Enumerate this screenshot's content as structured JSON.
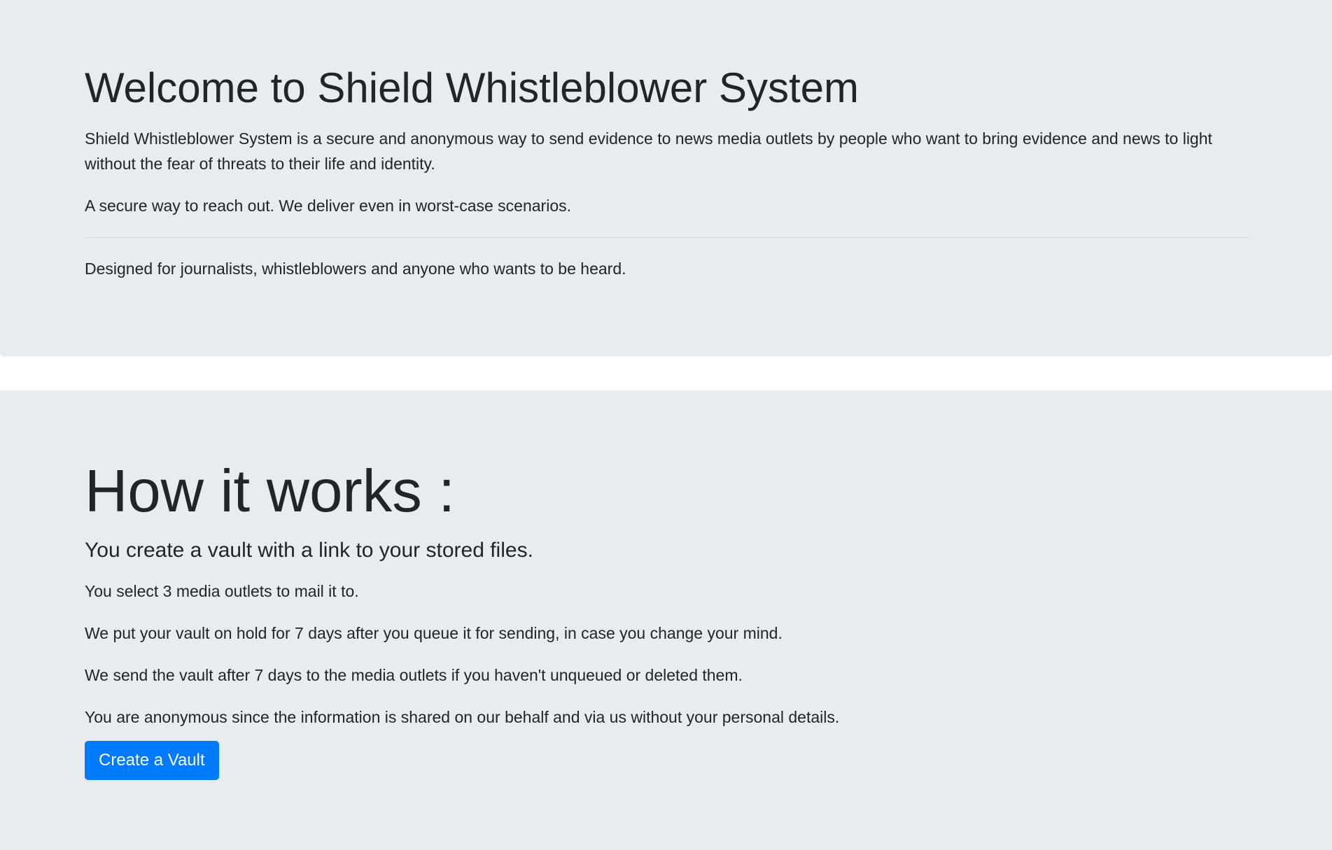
{
  "welcome": {
    "title": "Welcome to Shield Whistleblower System",
    "description": "Shield Whistleblower System is a secure and anonymous way to send evidence to news media outlets by people who want to bring evidence and news to light without the fear of threats to their life and identity.",
    "tagline": "A secure way to reach out. We deliver even in worst-case scenarios.",
    "audience": "Designed for journalists, whistleblowers and anyone who wants to be heard."
  },
  "how_it_works": {
    "title": "How it works :",
    "subheading": "You create a vault with a link to your stored files.",
    "steps": [
      "You select 3 media outlets to mail it to.",
      "We put your vault on hold for 7 days after you queue it for sending, in case you change your mind.",
      "We send the vault after 7 days to the media outlets if you haven't unqueued or deleted them.",
      "You are anonymous since the information is shared on our behalf and via us without your personal details."
    ],
    "cta_label": "Create a Vault"
  },
  "colors": {
    "jumbotron_bg": "#e9ecef",
    "primary": "#007bff",
    "text": "#212529"
  }
}
